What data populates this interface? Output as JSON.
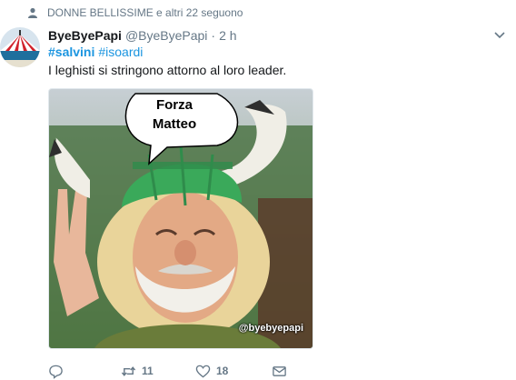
{
  "social_context": {
    "icon": "person-icon",
    "text": "DONNE BELLISSIME e altri 22 seguono"
  },
  "tweet": {
    "fullname": "ByeByePapi",
    "handle": "@ByeByePapi",
    "separator": "·",
    "time": "2 h",
    "hashtags": [
      "#salvini",
      "#isoardi"
    ],
    "text": "I leghisti si stringono attorno al loro leader.",
    "media": {
      "bubble_line1": "Forza",
      "bubble_line2": "Matteo",
      "watermark": "@byebyepapi"
    },
    "actions": {
      "reply_count": "",
      "retweet_count": "11",
      "like_count": "18"
    }
  },
  "colors": {
    "link": "#1b95e0",
    "muted": "#657786",
    "helmet": "#3aa95a"
  }
}
